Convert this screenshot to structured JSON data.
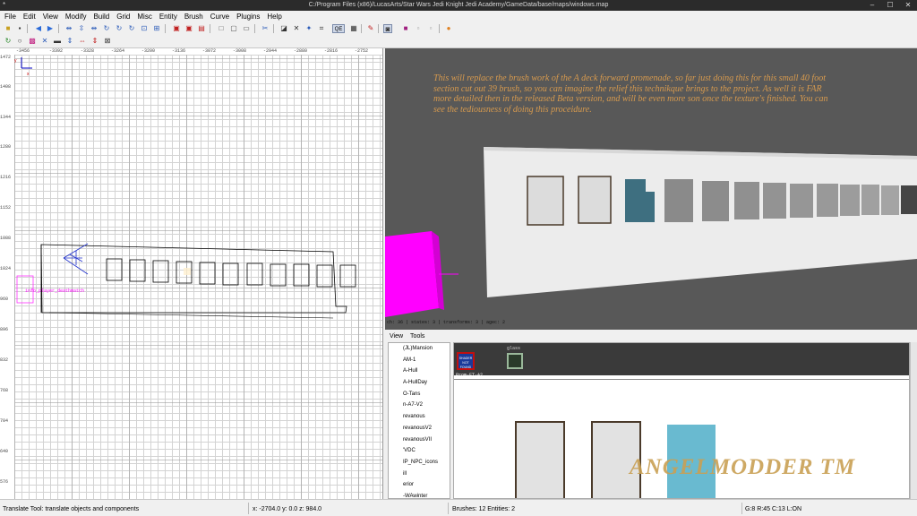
{
  "window": {
    "title": "C:/Program Files (x86)/LucasArts/Star Wars Jedi Knight Jedi Academy/GameData/base/maps/windows.map",
    "app_icon": "*",
    "minimize": "–",
    "maximize": "☐",
    "close": "✕"
  },
  "menu": [
    "File",
    "Edit",
    "View",
    "Modify",
    "Build",
    "Grid",
    "Misc",
    "Entity",
    "Brush",
    "Curve",
    "Plugins",
    "Help"
  ],
  "toolbar_icons": [
    "open-icon",
    "save-icon",
    "undo-icon",
    "redo-icon",
    "flip-x-icon",
    "flip-y-icon",
    "flip-z-icon",
    "rotate-x-icon",
    "rotate-y-icon",
    "rotate-z-icon",
    "select-complete-tall-icon",
    "select-touching-icon",
    "select-partial-tall-icon",
    "select-inside-icon",
    "csg-subtract-icon",
    "csg-merge-icon",
    "hollow-icon",
    "clipper-icon",
    "change-views-icon",
    "camera-icon",
    "cubic-clip-icon",
    "texture-lock-icon",
    "entity-icon",
    "qe-icon",
    "brush-tool-icon",
    "patch-icon",
    "shader-icon",
    "filter-icon",
    "plugin-icon"
  ],
  "left_view": {
    "ruler_top": [
      "-3456",
      "-3392",
      "-3328",
      "-3264",
      "-3200",
      "-3136",
      "-3072",
      "-3008",
      "-2944",
      "-2880",
      "-2816",
      "-2752"
    ],
    "ruler_left": [
      "1472",
      "1408",
      "1344",
      "1280",
      "1216",
      "1152",
      "1088",
      "1024",
      "960",
      "896",
      "832",
      "768",
      "704",
      "640",
      "576"
    ],
    "axis_x": "x",
    "axis_y": "y",
    "entity_label": "info_player_deathmatch",
    "colors": {
      "brush": "#000000",
      "entity": "#ff00ff",
      "light": "#0000ff"
    }
  },
  "camera": {
    "annotation": "This will replace the brush work of the A deck forward promenade, so far just doing this for this small 40 foot section cut out 39 brush, so you can imagine the relief this technikque brings to the project. As well it is FAR more detailed then in the released Beta version, and will be even more son once the texture's finished. You can see the tediousness of doing this proceidure.",
    "stats": "ch: 36 | states: 3 | transforms: 3 | agec: 2"
  },
  "texture_browser": {
    "menu": [
      "View",
      "Tools"
    ],
    "tree": [
      "(JL)Mansion",
      "AM-1",
      "A-Hull",
      "A-HullDay",
      "O-Tans",
      "n-A7-V2",
      "revanous",
      "revanousV2",
      "revanousVII",
      "'VDC",
      "IP_NPC_icons",
      "ill",
      "erior",
      "-WAwinter"
    ],
    "shader_notfound": "SHADER NOT FOUND",
    "texture_glass": "glass",
    "texture_current": "Prom-FT-A2",
    "watermark": "ANGELMODDER TM"
  },
  "status": {
    "tool": "Translate Tool: translate objects and components",
    "coords": "x:  -2704.0  y:     0.0  z:    984.0",
    "brushes": "Brushes: 12 Entities: 2",
    "grid": "G:8  R:45  C:13  L:ON"
  }
}
